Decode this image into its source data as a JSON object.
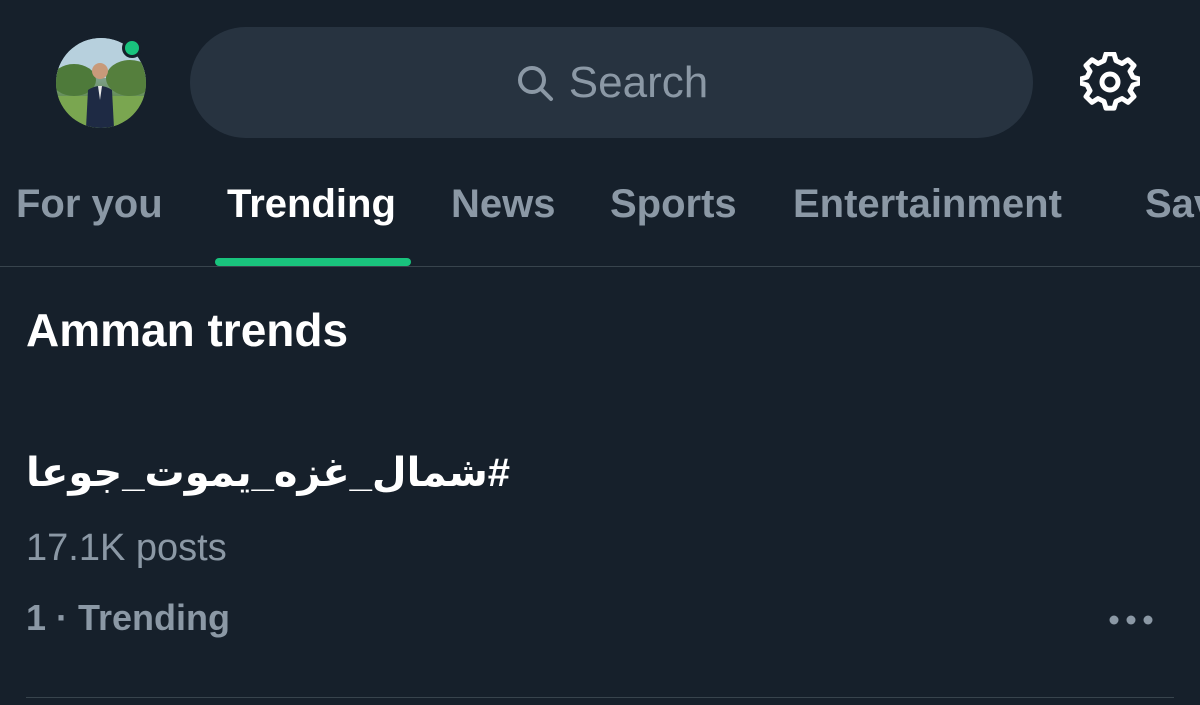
{
  "header": {
    "search_placeholder": "Search",
    "status_color": "#19c37d",
    "icons": [
      "avatar",
      "search-icon",
      "gear-icon"
    ]
  },
  "tabs": [
    {
      "label": "For you",
      "active": false
    },
    {
      "label": "Trending",
      "active": true
    },
    {
      "label": "News",
      "active": false
    },
    {
      "label": "Sports",
      "active": false
    },
    {
      "label": "Entertainment",
      "active": false
    },
    {
      "label": "Sav",
      "active": false
    }
  ],
  "accent_color": "#19c37d",
  "section": {
    "title": "Amman trends",
    "trends": [
      {
        "name": "#شمال_غزه_يموت_جوعا",
        "posts": "17.1K posts",
        "rank": "1 · Trending"
      }
    ]
  }
}
